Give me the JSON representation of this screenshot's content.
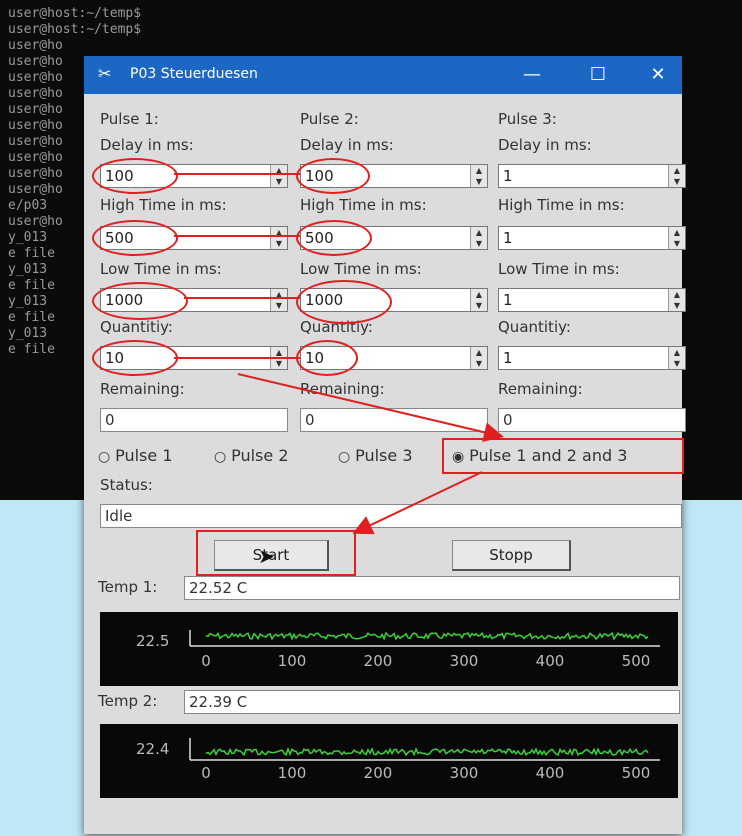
{
  "terminal": {
    "lines": [
      "user@host:~/temp$",
      "user@host:~/temp$",
      "user@ho",
      "user@ho",
      "user@ho",
      "user@ho",
      "user@ho",
      "user@ho",
      "user@ho",
      "user@ho",
      "user@ho",
      "user@ho",
      "e/p03",
      "user@ho",
      "y_013",
      "e file",
      "y_013",
      "e file",
      "y_013",
      "e file",
      "y_013",
      "e file"
    ]
  },
  "window": {
    "title": "P03 Steuerduesen",
    "app_icon": "tool-icon",
    "controls": {
      "minimize": "—",
      "maximize": "☐",
      "close": "✕"
    }
  },
  "pulses": [
    {
      "header": "Pulse 1:",
      "delay_label": "Delay in ms:",
      "delay": "100",
      "high_label": "High Time in ms:",
      "high": "500",
      "low_label": "Low Time in ms:",
      "low": "1000",
      "qty_label": "Quantitiy:",
      "qty": "10",
      "rem_label": "Remaining:",
      "rem": "0"
    },
    {
      "header": "Pulse 2:",
      "delay_label": "Delay in ms:",
      "delay": "100",
      "high_label": "High Time in ms:",
      "high": "500",
      "low_label": "Low Time in ms:",
      "low": "1000",
      "qty_label": "Quantitiy:",
      "qty": "10",
      "rem_label": "Remaining:",
      "rem": "0"
    },
    {
      "header": "Pulse 3:",
      "delay_label": "Delay in ms:",
      "delay": "1",
      "high_label": "High Time in ms:",
      "high": "1",
      "low_label": "Low Time in ms:",
      "low": "1",
      "qty_label": "Quantitiy:",
      "qty": "1",
      "rem_label": "Remaining:",
      "rem": "0"
    }
  ],
  "radios": [
    {
      "label": "Pulse 1",
      "selected": false
    },
    {
      "label": "Pulse 2",
      "selected": false
    },
    {
      "label": "Pulse 3",
      "selected": false
    },
    {
      "label": "Pulse 1 and 2 and 3",
      "selected": true
    }
  ],
  "status": {
    "label": "Status:",
    "value": "Idle"
  },
  "buttons": {
    "start": "Start",
    "stop": "Stopp"
  },
  "temps": [
    {
      "label": "Temp 1:",
      "value": "22.52 C",
      "ytick": "22.5",
      "xticks": [
        "0",
        "100",
        "200",
        "300",
        "400",
        "500"
      ]
    },
    {
      "label": "Temp 2:",
      "value": "22.39 C",
      "ytick": "22.4",
      "xticks": [
        "0",
        "100",
        "200",
        "300",
        "400",
        "500"
      ]
    }
  ],
  "colors": {
    "titlebar": "#1c67c4",
    "highlight": "#e02020",
    "plot_line": "#3bd13b",
    "plot_bg": "#080808"
  }
}
